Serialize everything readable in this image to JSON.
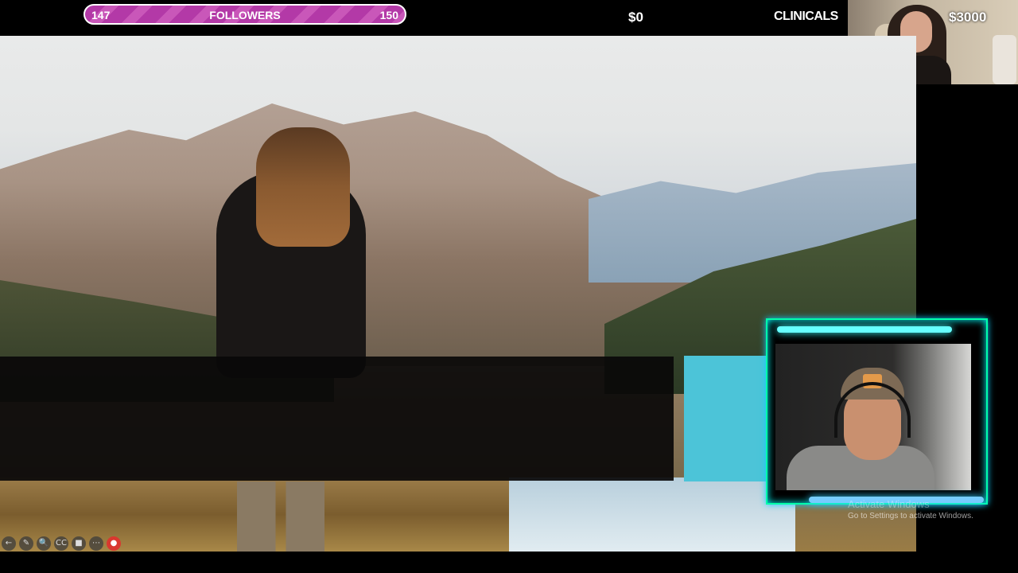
{
  "overlay": {
    "followers_current": "147",
    "followers_label": "FOLLOWERS",
    "followers_goal": "150",
    "followers_progress": 0.98,
    "money": "$0",
    "clinicals_label": "CLINICALS",
    "clinicals_goal": "$3000"
  },
  "windows_watermark": {
    "title": "Activate Windows",
    "subtitle": "Go to Settings to activate Windows."
  },
  "slide_controls": {
    "icons": [
      "back-icon",
      "pen-icon",
      "zoom-icon",
      "cc-icon",
      "video-icon",
      "more-icon",
      "record-icon"
    ],
    "glyphs": [
      "←",
      "✎",
      "🔍",
      "CC",
      "■",
      "⋯",
      "●"
    ]
  },
  "colors": {
    "followers_bar": "#b339a7",
    "accent": "#4cc4d8",
    "cam_glow": "#33ffff"
  }
}
